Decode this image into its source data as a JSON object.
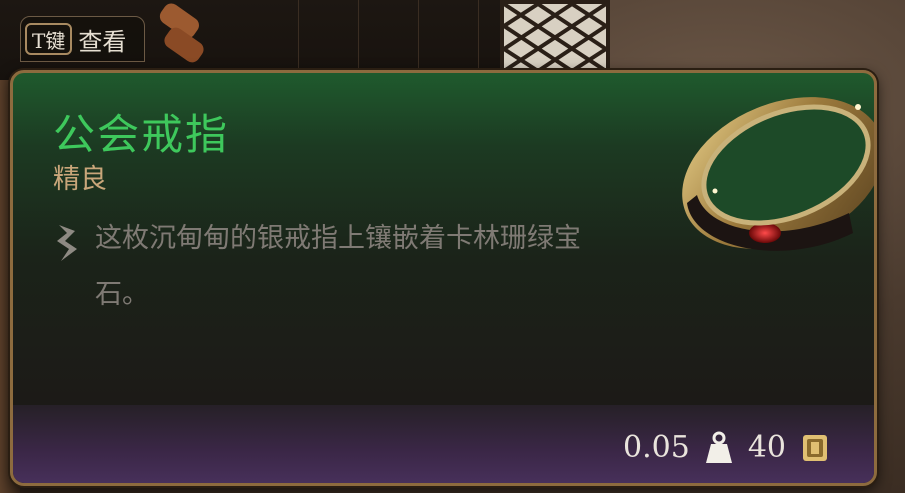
{
  "key_hint": {
    "key": "T键",
    "action": "查看"
  },
  "item": {
    "name": "公会戒指",
    "rarity": "精良",
    "description": "这枚沉甸甸的银戒指上镶嵌着卡林珊绿宝石。",
    "weight": "0.05",
    "value": "40",
    "image_icon": "ring-with-gem-icon"
  },
  "icons": {
    "description_bullet": "feather-bullet-icon",
    "weight": "weight-icon",
    "value": "gold-coin-icon"
  },
  "colors": {
    "name_green": "#3ec85c",
    "rarity_tan": "#c9a67a",
    "description_gray": "#7f7a74",
    "border_gold": "#8d6b3e",
    "footer_purple": "#47305a"
  }
}
